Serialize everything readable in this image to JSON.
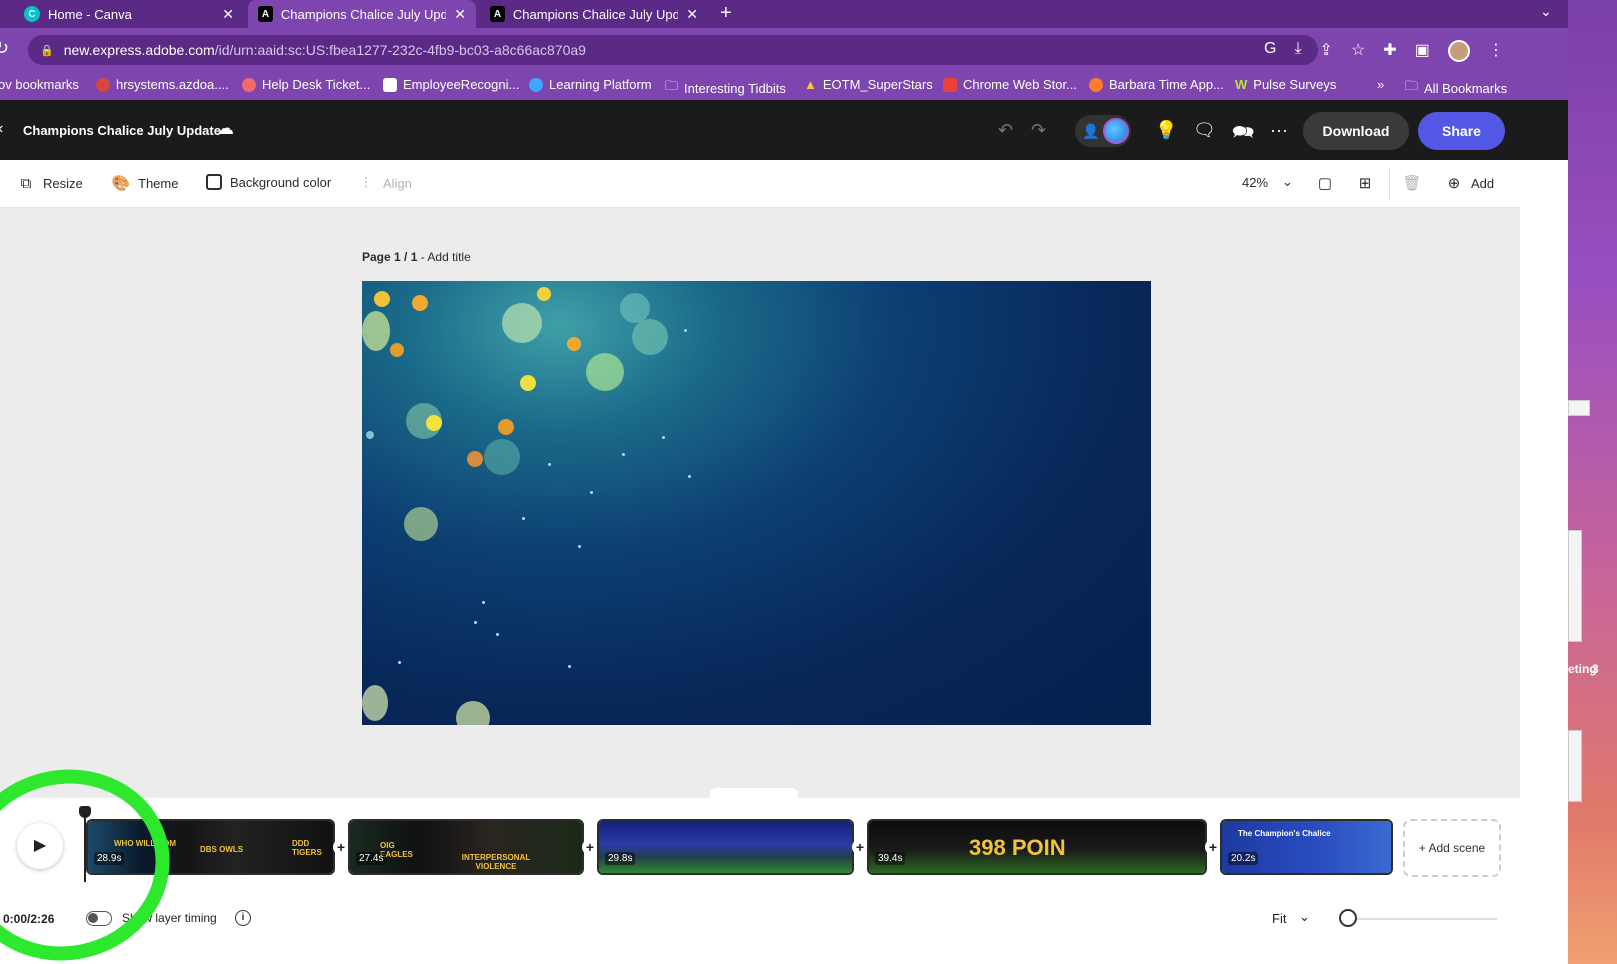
{
  "tabs": [
    {
      "title": "Home - Canva",
      "icon": "canva-icon",
      "active": false
    },
    {
      "title": "Champions Chalice July Updat",
      "icon": "adobe-express-icon",
      "active": true
    },
    {
      "title": "Champions Chalice July Updat",
      "icon": "adobe-express-icon",
      "active": false
    }
  ],
  "url": {
    "host": "new.express.adobe.com",
    "path": "/id/urn:aaid:sc:US:fbea1277-232c-4fb9-bc03-a8c66ac870a9"
  },
  "bookmarks": [
    "ov bookmarks",
    "hrsystems.azdoa....",
    "Help Desk Ticket...",
    "EmployeeRecogni...",
    "Learning Platform",
    "Interesting Tidbits",
    "EOTM_SuperStars",
    "Chrome Web Stor...",
    "Barbara Time App...",
    "Pulse Surveys"
  ],
  "bookmarks_overflow": "»",
  "all_bookmarks": "All Bookmarks",
  "header": {
    "doc_title": "Champions Chalice July Update",
    "download": "Download",
    "share": "Share"
  },
  "toolbar": {
    "resize": "Resize",
    "theme": "Theme",
    "background_color": "Background color",
    "align": "Align",
    "zoom": "42%",
    "add": "Add"
  },
  "page": {
    "label": "Page 1 / 1",
    "sep": " - ",
    "add_title": "Add title"
  },
  "timeline": {
    "scenes": [
      {
        "duration": "28.9s",
        "captions": [
          "WHO WILL COM",
          "DBS OWLS",
          "DDD TIGERS"
        ]
      },
      {
        "duration": "27.4s",
        "captions": [
          "OIG EAGLES",
          "INTERPERSONAL VIOLENCE"
        ]
      },
      {
        "duration": "29.8s",
        "captions": []
      },
      {
        "duration": "39.4s",
        "captions": [
          "398 POIN"
        ]
      },
      {
        "duration": "20.2s",
        "captions": [
          "The Champion's Chalice"
        ]
      }
    ],
    "add_scene": "+ Add scene",
    "timecode": "0:00/2:26",
    "layer_timing": "Show layer timing",
    "fit": "Fit"
  },
  "desktop": {
    "label1": "eting",
    "label2": "3"
  },
  "colors": {
    "accent": "#5258e4",
    "browser_chrome": "#7d45ad",
    "annotation": "#2ee82e"
  }
}
